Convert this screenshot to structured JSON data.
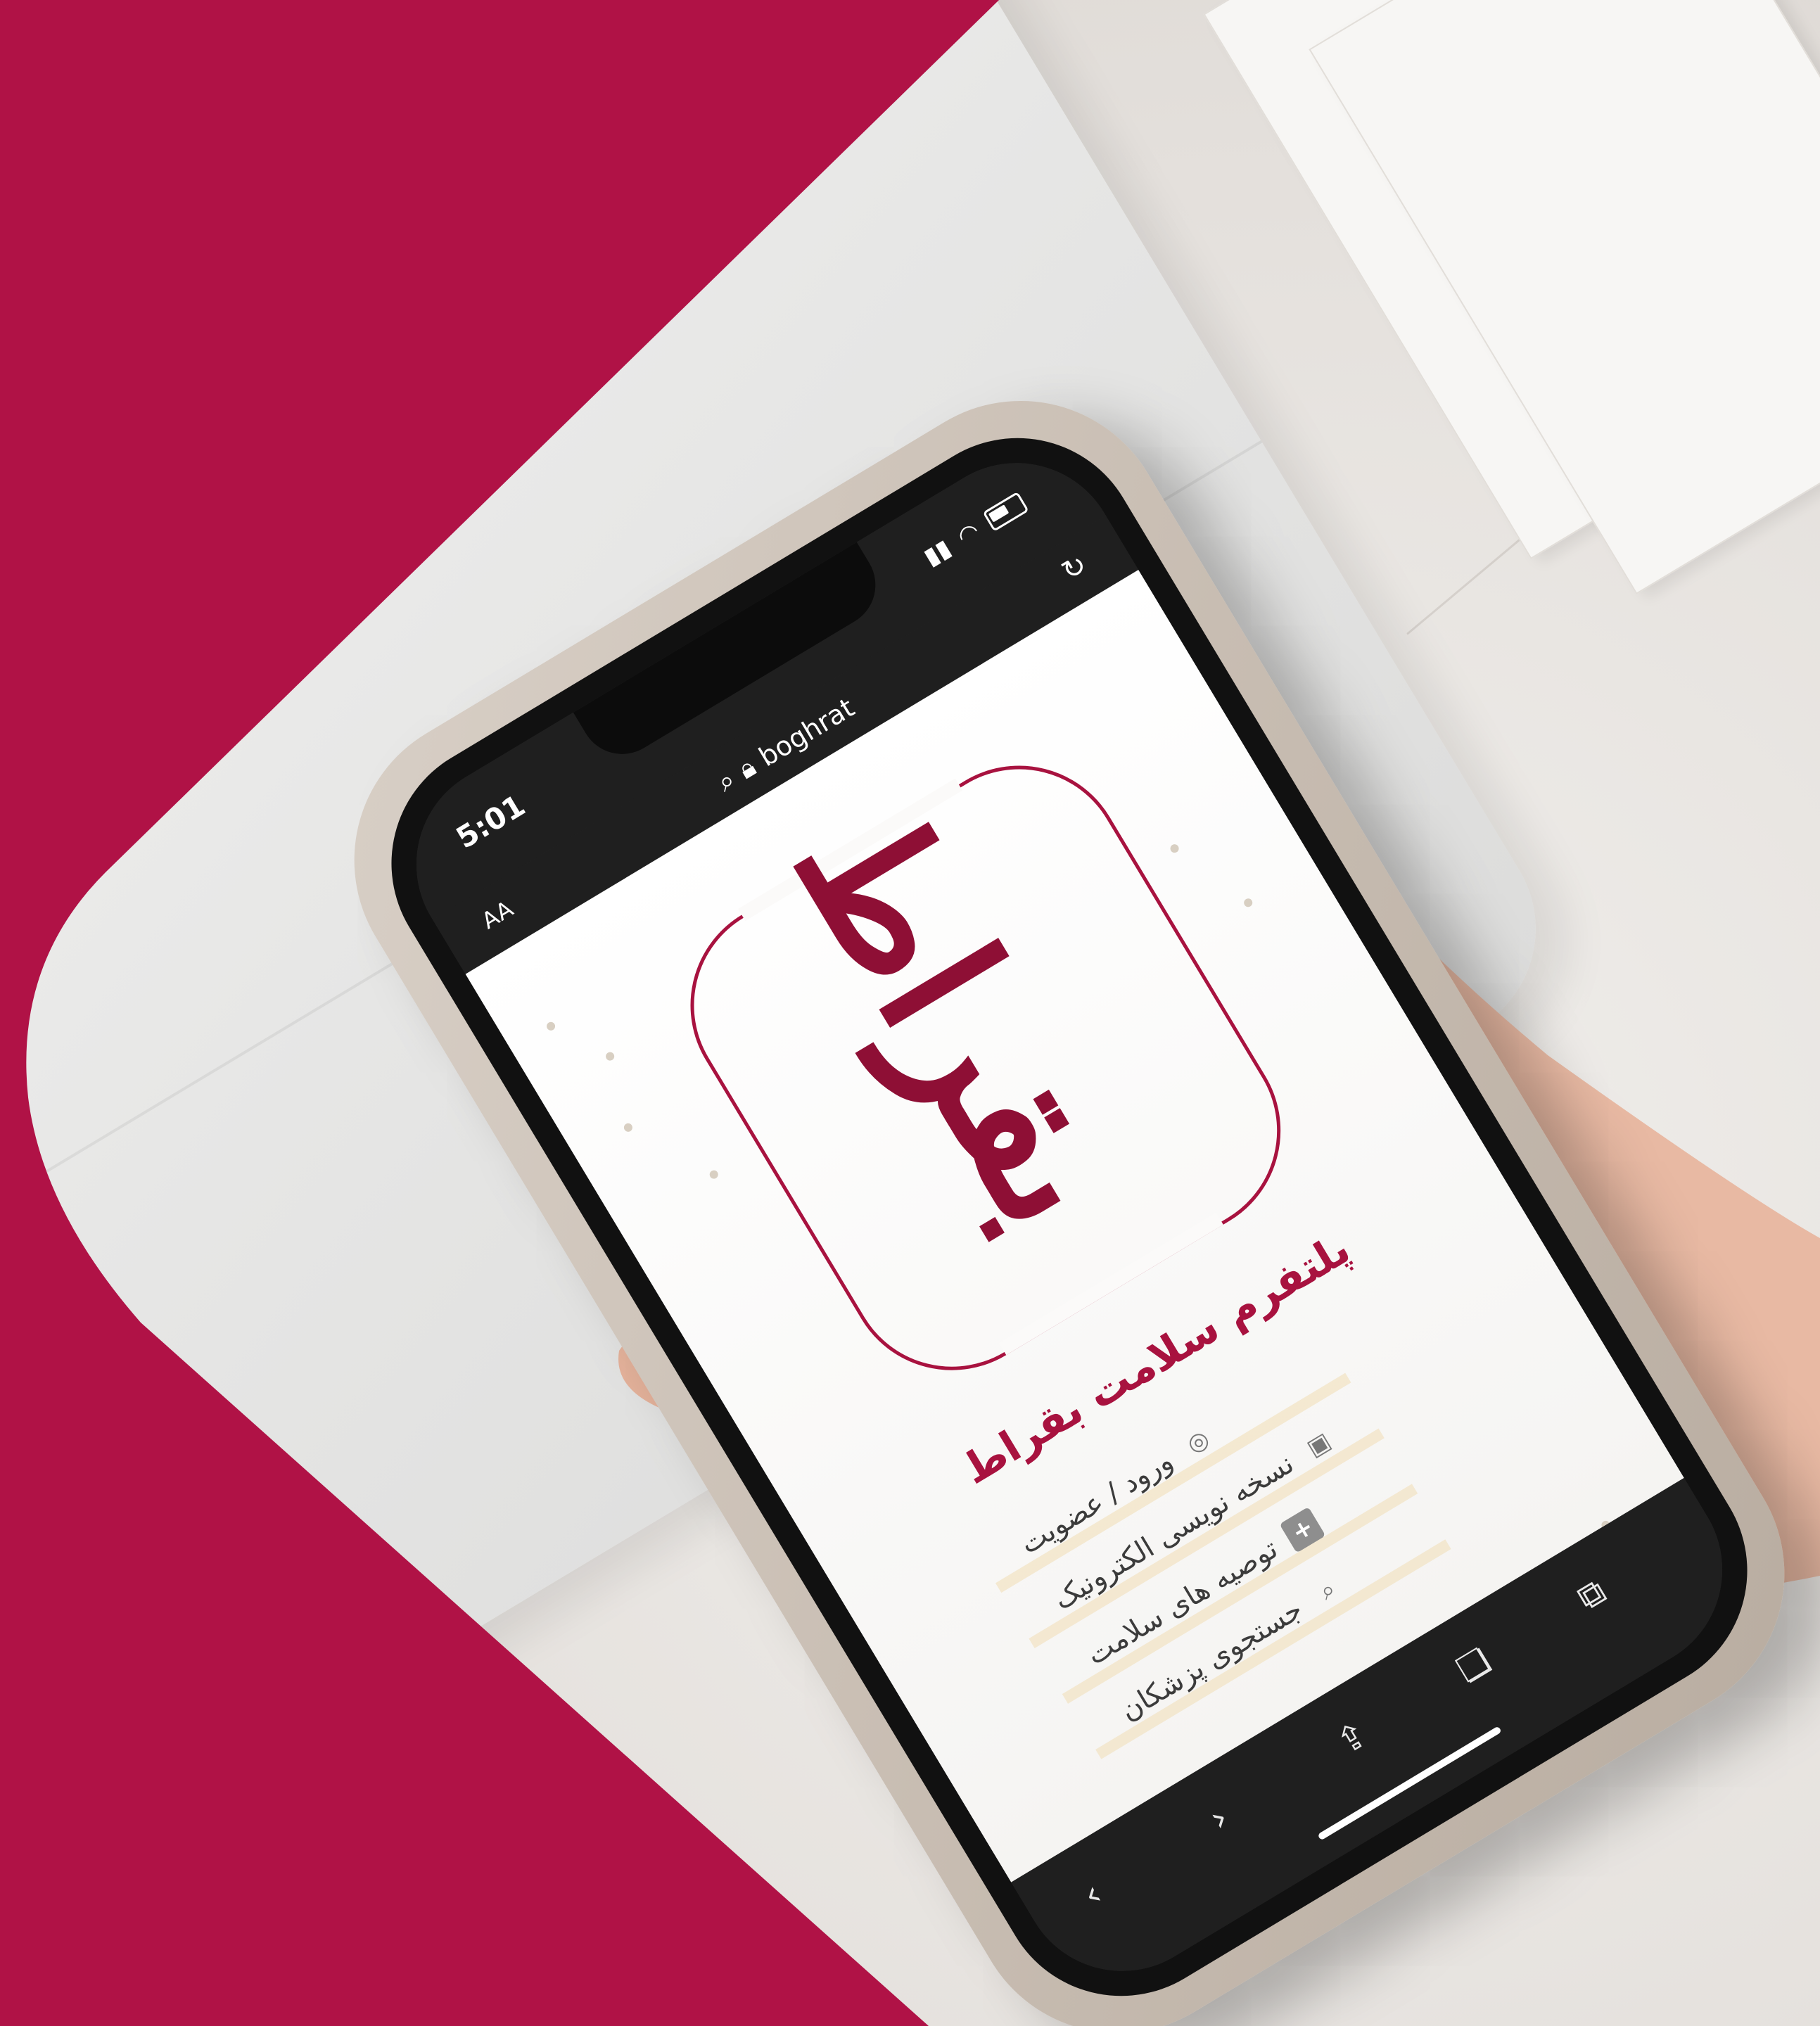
{
  "colors": {
    "brand": "#a8123f",
    "brand_dark": "#8e0f35",
    "background_panel": "#b01246",
    "marble": "#e9e6e3"
  },
  "status_bar": {
    "time": "5:01",
    "location_icon": "location-arrow-icon",
    "signal_icon": "signal-icon",
    "wifi_icon": "wifi-icon",
    "battery_icon": "battery-icon"
  },
  "browser": {
    "text_size_label": "AA",
    "url": "boghrat",
    "search_icon": "search-icon",
    "lock_icon": "lock-icon",
    "reload_icon": "reload-icon"
  },
  "site": {
    "logo_text": "بقراط",
    "tagline": "پلتفرم سلامت بقراط",
    "menu": [
      {
        "label": "ورود / عضویت",
        "icon": "fingerprint-icon"
      },
      {
        "label": "نسخه نویسی الکترونیک",
        "icon": "prescription-icon"
      },
      {
        "label": "توصیه های سلامت",
        "icon": "medical-cross-icon"
      },
      {
        "label": "جستجوی پزشکان",
        "icon": "search-icon"
      }
    ]
  },
  "toolbar": {
    "back_icon": "back-chevron-icon",
    "forward_icon": "forward-chevron-icon",
    "share_icon": "share-icon",
    "bookmarks_icon": "bookmarks-icon",
    "tabs_icon": "tabs-icon"
  }
}
